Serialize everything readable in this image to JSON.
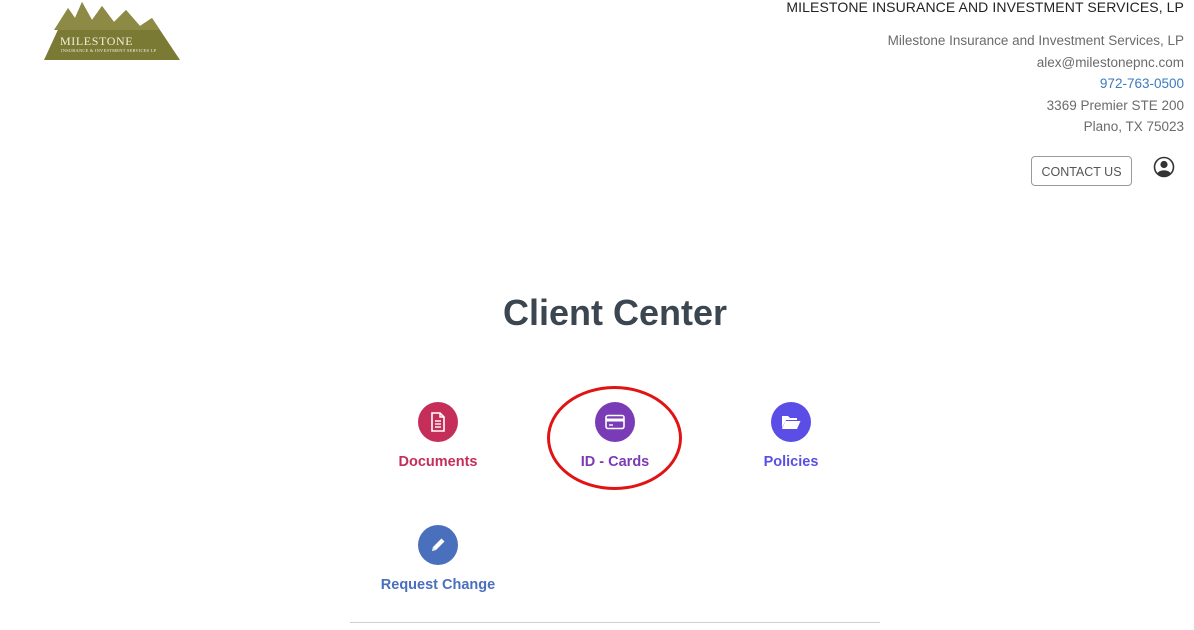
{
  "header": {
    "logo": {
      "name": "MILESTONE",
      "subtitle": "INSURANCE & INVESTMENT SERVICES LP"
    },
    "agency_name": "MILESTONE INSURANCE AND INVESTMENT SERVICES, LP",
    "contact": {
      "company": "Milestone Insurance and Investment Services, LP",
      "email": "alex@milestonepnc.com",
      "phone": "972-763-0500",
      "address_line1": "3369 Premier STE 200",
      "address_line2": "Plano, TX 75023"
    },
    "contact_button": "CONTACT US",
    "user_icon": "user-circle-icon"
  },
  "main": {
    "title": "Client Center",
    "tiles": [
      {
        "label": "Documents",
        "icon": "document-icon",
        "color": "#c42e59"
      },
      {
        "label": "ID - Cards",
        "icon": "credit-card-icon",
        "color": "#7a3cb6"
      },
      {
        "label": "Policies",
        "icon": "folder-open-icon",
        "color": "#5a4ee6"
      },
      {
        "label": "Request Change",
        "icon": "pencil-icon",
        "color": "#4a6fbd"
      }
    ],
    "highlight_color": "#e01414"
  }
}
